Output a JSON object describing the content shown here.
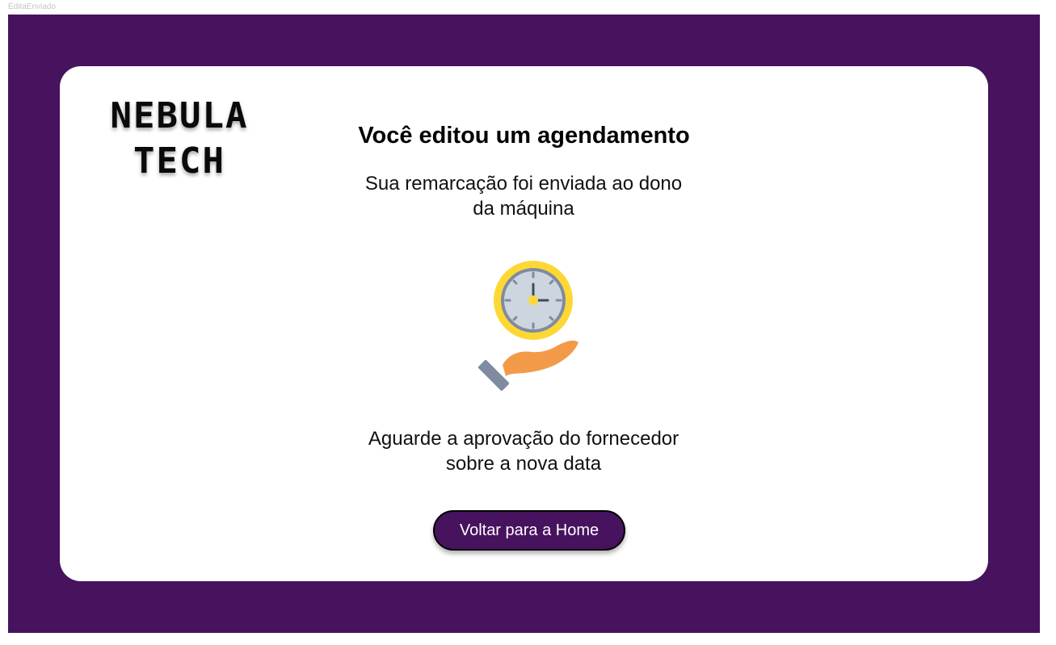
{
  "frame": {
    "label": "EditaEnviado",
    "background": "#47125e"
  },
  "logo": {
    "line1": "NEBULA",
    "line2": "TECH"
  },
  "content": {
    "title": "Você editou um agendamento",
    "subtitle": "Sua remarcação foi enviada ao dono da máquina",
    "illustration_icon": "clock-in-hand-icon",
    "waiting_text": "Aguarde a aprovação do fornecedor sobre a nova data"
  },
  "actions": {
    "home_button_label": "Voltar para a Home",
    "home_button_color": "#47125e"
  }
}
